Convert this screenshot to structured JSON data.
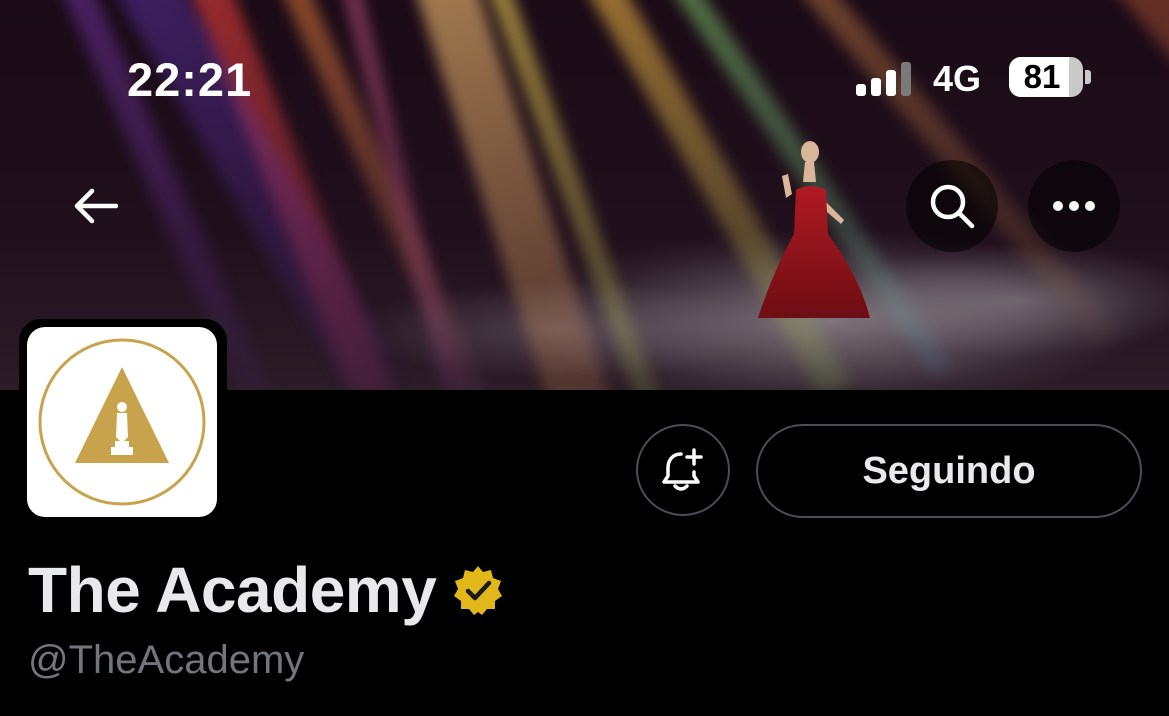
{
  "status_bar": {
    "time": "22:21",
    "network": "4G",
    "battery_level": "81",
    "battery_fraction": 0.81
  },
  "header": {
    "back_icon": "arrow-left-icon",
    "search_icon": "search-icon",
    "more_icon": "more-horizontal-icon"
  },
  "profile": {
    "display_name": "The Academy",
    "handle": "@TheAcademy",
    "verified_badge": "gold-verified-badge-icon",
    "avatar": "academy-oscar-logo"
  },
  "actions": {
    "notify_icon": "bell-plus-icon",
    "follow_label": "Seguindo"
  },
  "colors": {
    "background": "#000000",
    "text_primary": "#e7e9ea",
    "text_secondary": "#71767b",
    "button_border": "#4a4f54",
    "verified_gold": "#e2b719",
    "logo_gold": "#c9a24c"
  }
}
